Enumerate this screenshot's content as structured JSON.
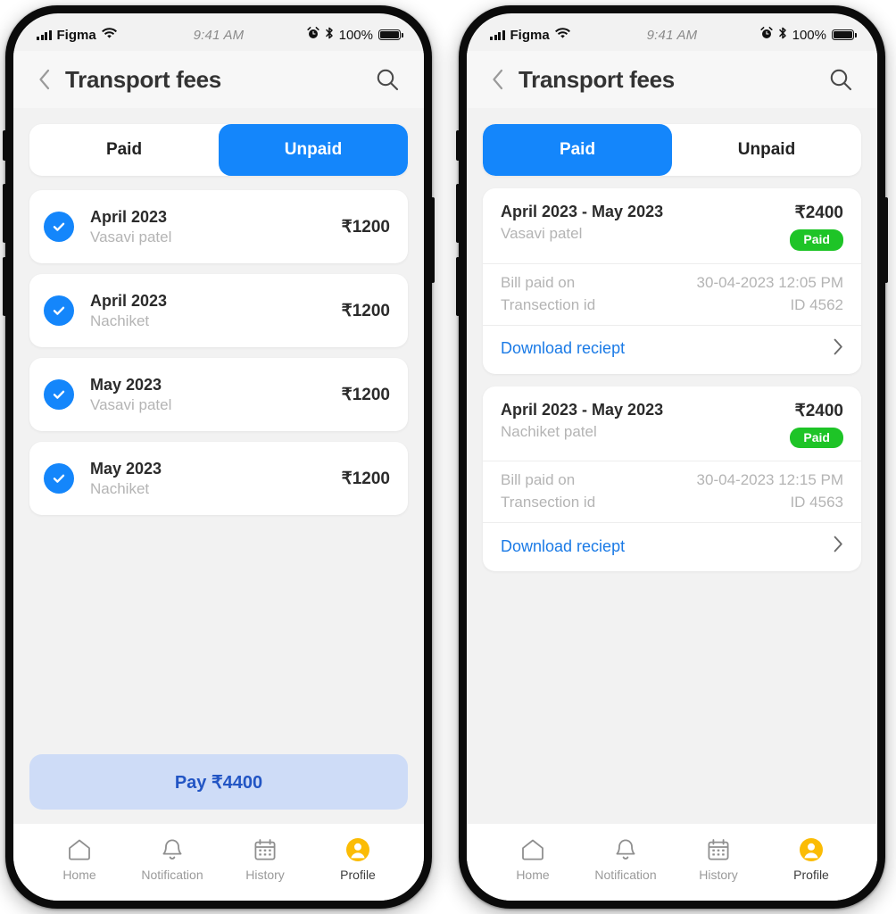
{
  "status_bar": {
    "carrier": "Figma",
    "time": "9:41 AM",
    "battery_percent": "100%",
    "icons": [
      "signal-bars-icon",
      "wifi-icon",
      "alarm-icon",
      "bluetooth-icon",
      "battery-icon"
    ]
  },
  "header": {
    "back_icon": "chevron-left-icon",
    "title": "Transport fees",
    "search_icon": "search-icon"
  },
  "colors": {
    "accent_blue": "#1486fb",
    "link_blue": "#1a7ae6",
    "paid_green": "#1ec427",
    "pay_button_bg": "#cedcf7",
    "pay_button_text": "#2255c4",
    "profile_yellow": "#fbbc05",
    "screen_bg": "#f2f2f2",
    "card_bg": "#ffffff"
  },
  "tabs": {
    "paid_label": "Paid",
    "unpaid_label": "Unpaid"
  },
  "left_phone": {
    "active_tab": "Unpaid",
    "unpaid_items": [
      {
        "month": "April 2023",
        "name": "Vasavi patel",
        "amount": "₹1200",
        "checked": true
      },
      {
        "month": "April 2023",
        "name": "Nachiket",
        "amount": "₹1200",
        "checked": true
      },
      {
        "month": "May 2023",
        "name": "Vasavi patel",
        "amount": "₹1200",
        "checked": true
      },
      {
        "month": "May 2023",
        "name": "Nachiket",
        "amount": "₹1200",
        "checked": true
      }
    ],
    "pay_button_label": "Pay ₹4400"
  },
  "right_phone": {
    "active_tab": "Paid",
    "paid_cards": [
      {
        "period": "April 2023 - May 2023",
        "payer": "Vasavi patel",
        "amount": "₹2400",
        "badge": "Paid",
        "bill_paid_on_label": "Bill paid on",
        "bill_paid_on_value": "30-04-2023 12:05 PM",
        "transaction_label": "Transection id",
        "transaction_value": "ID 4562",
        "download_label": "Download reciept"
      },
      {
        "period": "April 2023 - May 2023",
        "payer": "Nachiket patel",
        "amount": "₹2400",
        "badge": "Paid",
        "bill_paid_on_label": "Bill paid on",
        "bill_paid_on_value": "30-04-2023 12:15 PM",
        "transaction_label": "Transection id",
        "transaction_value": "ID 4563",
        "download_label": "Download reciept"
      }
    ]
  },
  "bottom_nav": {
    "items": [
      {
        "label": "Home",
        "icon": "home-icon",
        "active": false
      },
      {
        "label": "Notification",
        "icon": "bell-icon",
        "active": false
      },
      {
        "label": "History",
        "icon": "calendar-icon",
        "active": false
      },
      {
        "label": "Profile",
        "icon": "user-avatar-icon",
        "active": true
      }
    ]
  }
}
